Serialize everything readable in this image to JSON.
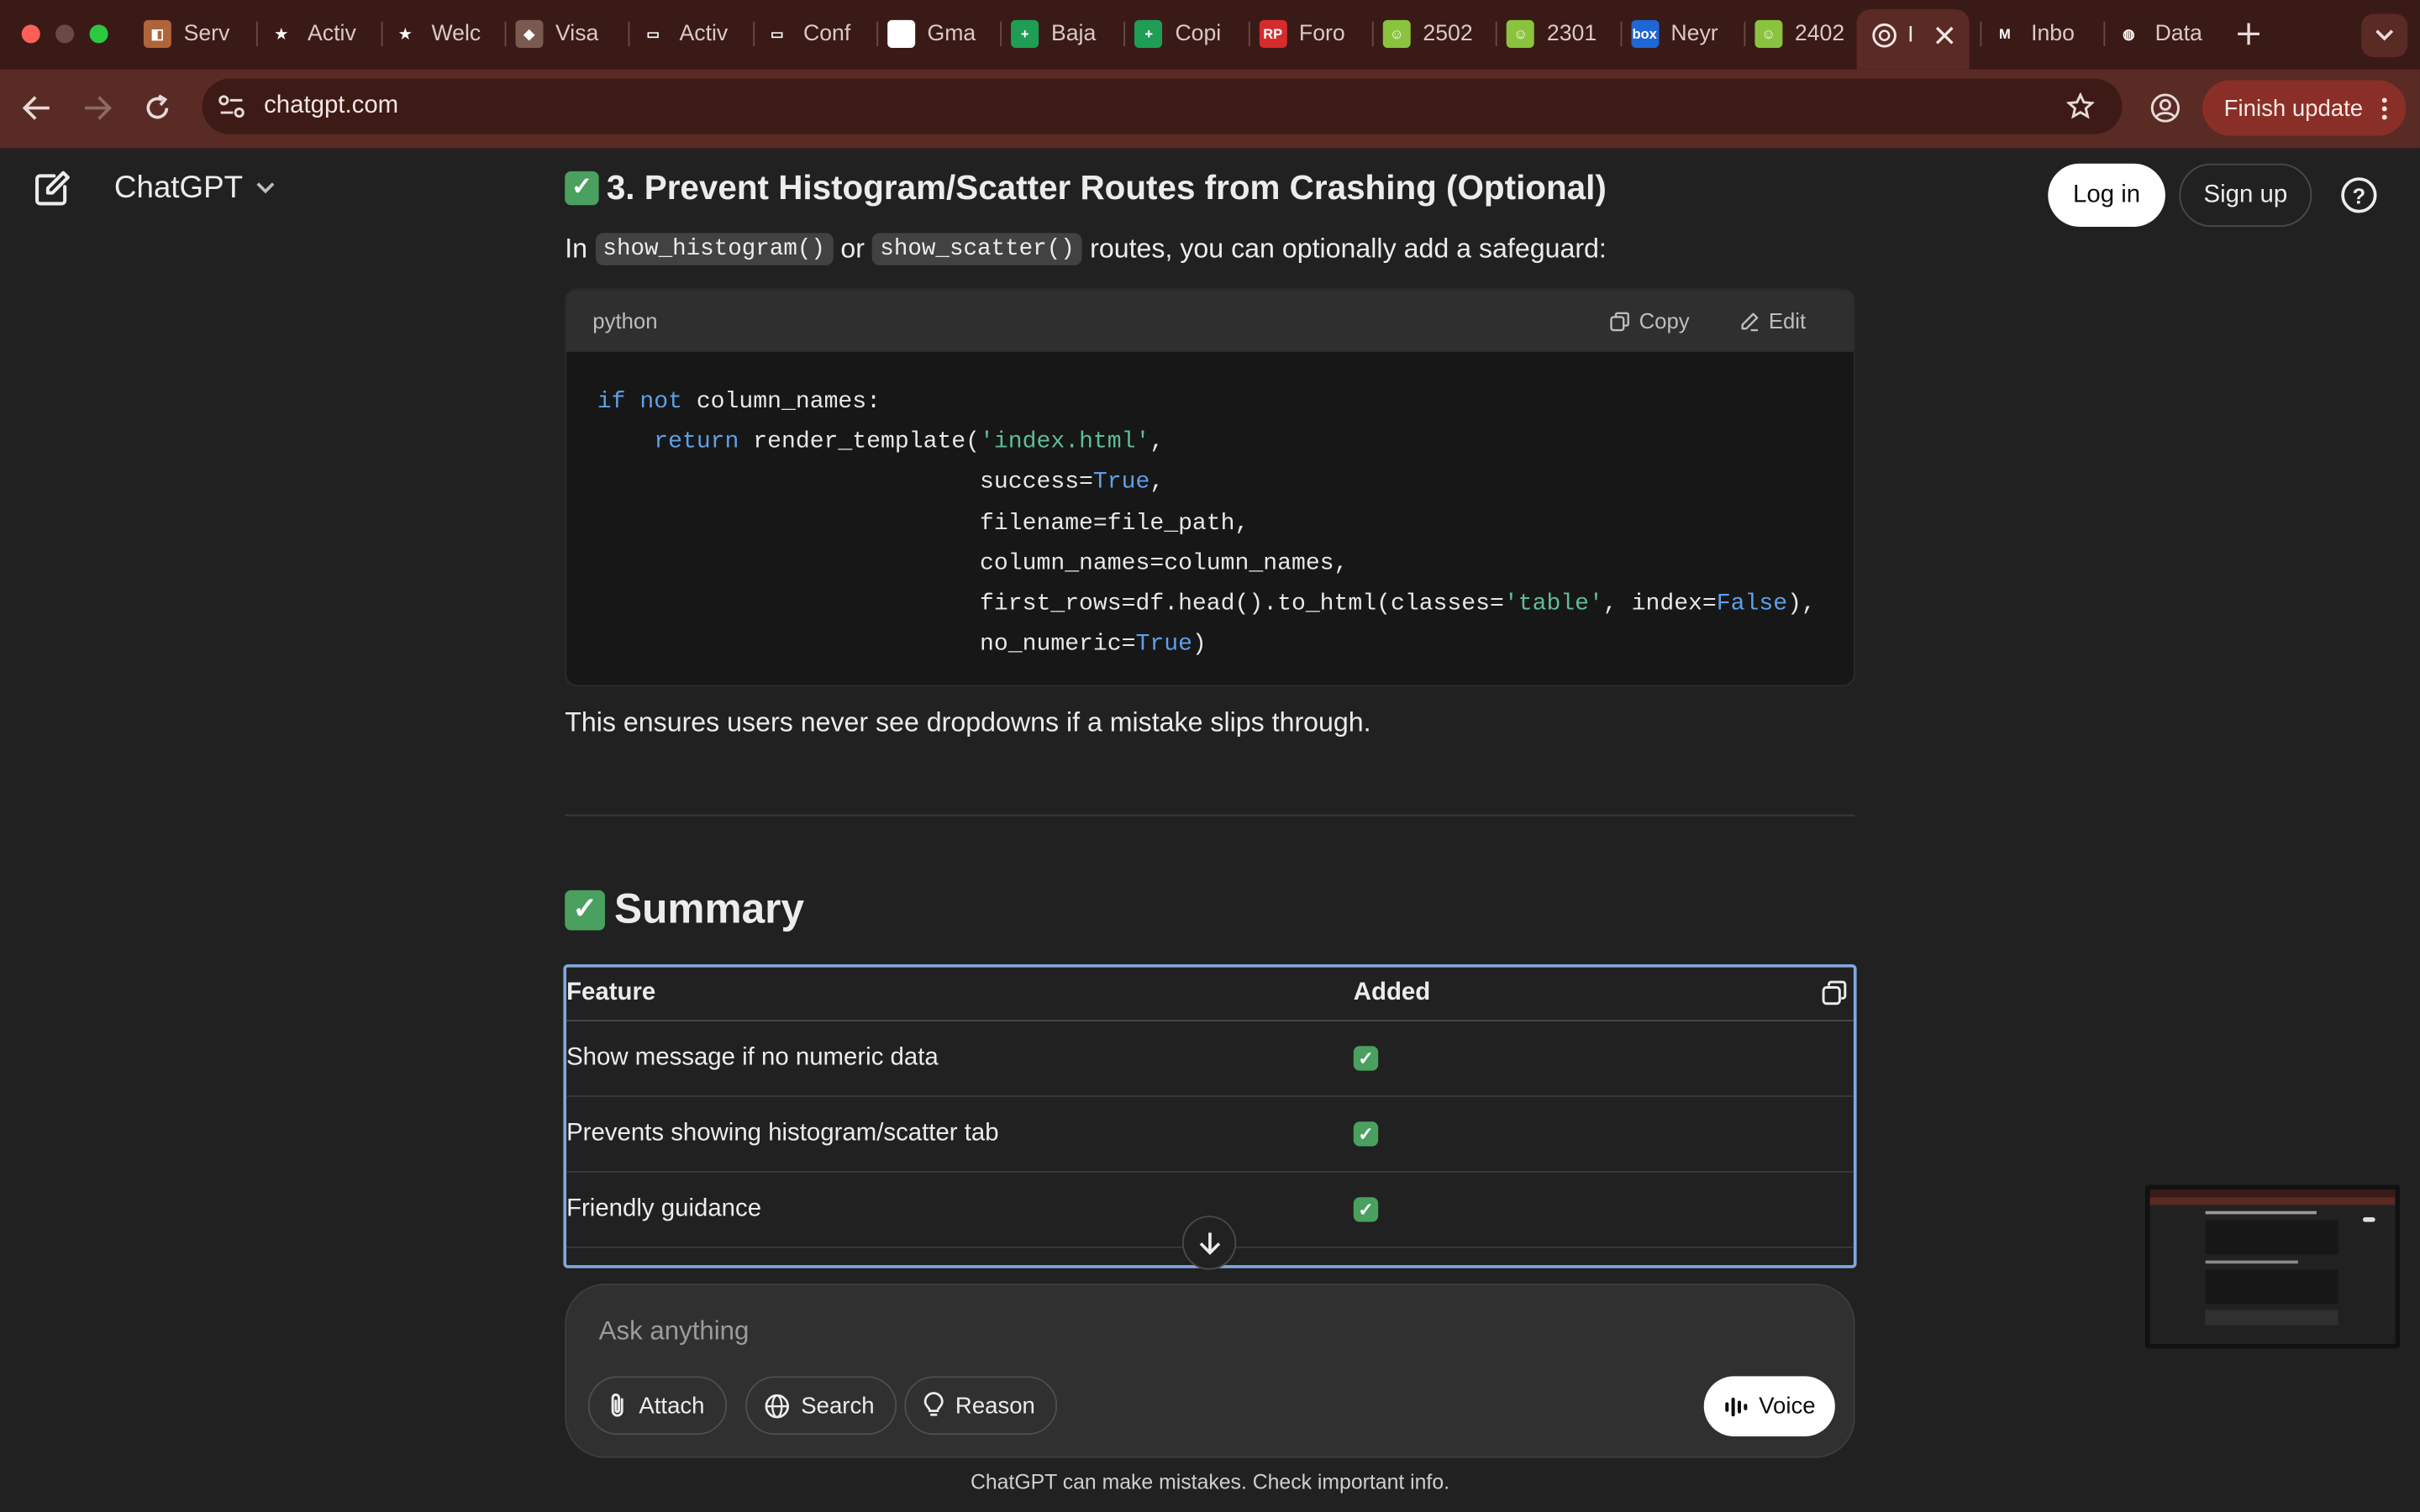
{
  "browser": {
    "tabs": [
      {
        "label": "Serv",
        "fav_color": "#b0643a",
        "glyph": "◧"
      },
      {
        "label": "Activ",
        "fav_color": "#3a1a17",
        "glyph": "★"
      },
      {
        "label": "Welc",
        "fav_color": "#3a1a17",
        "glyph": "★"
      },
      {
        "label": "Visa",
        "fav_color": "#7a5a50",
        "glyph": "◆"
      },
      {
        "label": "Activ",
        "fav_color": "#3a1a17",
        "glyph": "▭"
      },
      {
        "label": "Conf",
        "fav_color": "#3a1a17",
        "glyph": "▭"
      },
      {
        "label": "Gma",
        "fav_color": "#ffffff",
        "glyph": "G"
      },
      {
        "label": "Baja",
        "fav_color": "#1f9d55",
        "glyph": "+"
      },
      {
        "label": "Copi",
        "fav_color": "#1f9d55",
        "glyph": "+"
      },
      {
        "label": "Foro",
        "fav_color": "#d62b2b",
        "glyph": "RP"
      },
      {
        "label": "2502",
        "fav_color": "#8ac43f",
        "glyph": "☺"
      },
      {
        "label": "2301",
        "fav_color": "#8ac43f",
        "glyph": "☺"
      },
      {
        "label": "Neyr",
        "fav_color": "#1f66d6",
        "glyph": "box"
      },
      {
        "label": "2402",
        "fav_color": "#8ac43f",
        "glyph": "☺"
      }
    ],
    "active_tab": {
      "label": "I"
    },
    "tabs_after": [
      {
        "label": "Inbo",
        "fav_color": "#3a1a17",
        "glyph": "M"
      },
      {
        "label": "Data",
        "fav_color": "#3a1a17",
        "glyph": "◍"
      }
    ],
    "url": "chatgpt.com",
    "finish_update_label": "Finish update"
  },
  "header": {
    "brand": "ChatGPT",
    "login_label": "Log in",
    "signup_label": "Sign up",
    "help_label": "?"
  },
  "content": {
    "section3_title": "3. Prevent Histogram/Scatter Routes from Crashing (Optional)",
    "check_glyph": "✓",
    "para1": {
      "prefix": "In",
      "code1": "show_histogram()",
      "mid": "or",
      "code2": "show_scatter()",
      "suffix": "routes, you can optionally add a safeguard:"
    },
    "code_block": {
      "lang": "python",
      "copy_label": "Copy",
      "edit_label": "Edit",
      "lines": [
        [
          {
            "t": "if not",
            "c": "kw"
          },
          {
            "t": " column_names:",
            "c": ""
          }
        ],
        [
          {
            "t": "    ",
            "c": ""
          },
          {
            "t": "return",
            "c": "kw"
          },
          {
            "t": " render_template(",
            "c": ""
          },
          {
            "t": "'index.html'",
            "c": "st"
          },
          {
            "t": ",",
            "c": ""
          }
        ],
        [
          {
            "t": "                           success=",
            "c": ""
          },
          {
            "t": "True",
            "c": "kw"
          },
          {
            "t": ",",
            "c": ""
          }
        ],
        [
          {
            "t": "                           filename=file_path,",
            "c": ""
          }
        ],
        [
          {
            "t": "                           column_names=column_names,",
            "c": ""
          }
        ],
        [
          {
            "t": "                           first_rows=df.head().to_html(classes=",
            "c": ""
          },
          {
            "t": "'table'",
            "c": "st"
          },
          {
            "t": ", index=",
            "c": ""
          },
          {
            "t": "False",
            "c": "kw"
          },
          {
            "t": "),",
            "c": ""
          }
        ],
        [
          {
            "t": "                           no_numeric=",
            "c": ""
          },
          {
            "t": "True",
            "c": "kw"
          },
          {
            "t": ")",
            "c": ""
          }
        ]
      ]
    },
    "para2": "This ensures users never see dropdowns if a mistake slips through.",
    "summary_title": "Summary",
    "table": {
      "headers": [
        "Feature",
        "Added"
      ],
      "rows": [
        [
          "Show message if no numeric data",
          "✓"
        ],
        [
          "Prevents showing histogram/scatter tab",
          "✓"
        ],
        [
          "Friendly guidance",
          "✓"
        ]
      ]
    }
  },
  "composer": {
    "placeholder": "Ask anything",
    "attach_label": "Attach",
    "search_label": "Search",
    "reason_label": "Reason",
    "voice_label": "Voice"
  },
  "footer": "ChatGPT can make mistakes. Check important info."
}
